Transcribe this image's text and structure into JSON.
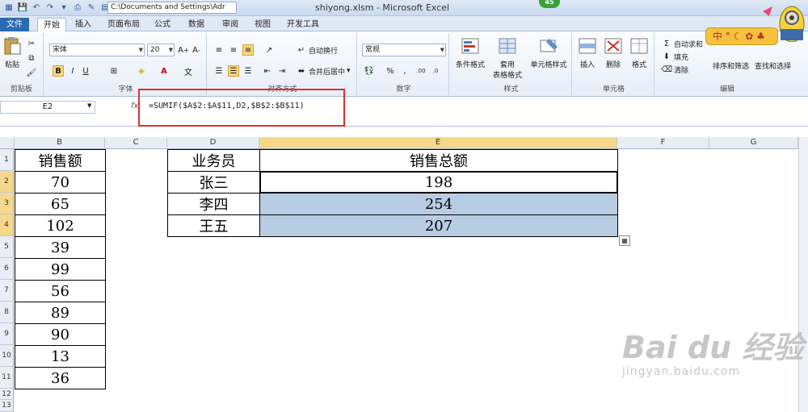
{
  "window": {
    "title": "shiyong.xlsm  -  Microsoft Excel",
    "path": "C:\\Documents and Settings\\Adr",
    "badge": "45"
  },
  "tabs": [
    "文件",
    "开始",
    "插入",
    "页面布局",
    "公式",
    "数据",
    "审阅",
    "视图",
    "开发工具"
  ],
  "ribbon": {
    "clipboard": {
      "paste": "粘贴",
      "label": "剪贴板"
    },
    "font": {
      "name": "宋体",
      "size": "20",
      "bold": "B",
      "italic": "I",
      "underline": "U",
      "label": "字体"
    },
    "alignment": {
      "wrap": "自动换行",
      "merge": "合并后居中",
      "label": "对齐方式"
    },
    "number": {
      "format": "常规",
      "percent": "%",
      "comma": ",",
      "label": "数字"
    },
    "styles": {
      "cond": "条件格式",
      "table": "套用\n表格格式",
      "cell": "单元格样式",
      "label": "样式"
    },
    "cells": {
      "insert": "插入",
      "delete": "删除",
      "format": "格式",
      "label": "单元格"
    },
    "editing": {
      "autosum": "自动求和",
      "fill": "填充",
      "clear": "清除",
      "sort": "排序和筛选",
      "find": "查找和选择",
      "label": "编辑"
    }
  },
  "ime": {
    "text": "中"
  },
  "formula_bar": {
    "name_box": "E2",
    "fx": "fx",
    "formula": "=SUMIF($A$2:$A$11,D2,$B$2:$B$11)"
  },
  "columns": [
    "B",
    "C",
    "D",
    "E",
    "F",
    "G"
  ],
  "rows": [
    "1",
    "2",
    "3",
    "4",
    "5",
    "6",
    "7",
    "8",
    "9",
    "10",
    "11",
    "12",
    "13"
  ],
  "col_b": [
    "销售额",
    "70",
    "65",
    "102",
    "39",
    "99",
    "56",
    "89",
    "90",
    "13",
    "36"
  ],
  "table": {
    "header": [
      "业务员",
      "销售总额"
    ],
    "rows": [
      [
        "张三",
        "198"
      ],
      [
        "李四",
        "254"
      ],
      [
        "王五",
        "207"
      ]
    ]
  },
  "watermark": {
    "line1": "Bai du 经验",
    "line2": "jingyan.baidu.com"
  },
  "colors": {
    "selection": "#b8cce4",
    "accent": "#2a6ab3",
    "highlight_box": "#e03030"
  }
}
